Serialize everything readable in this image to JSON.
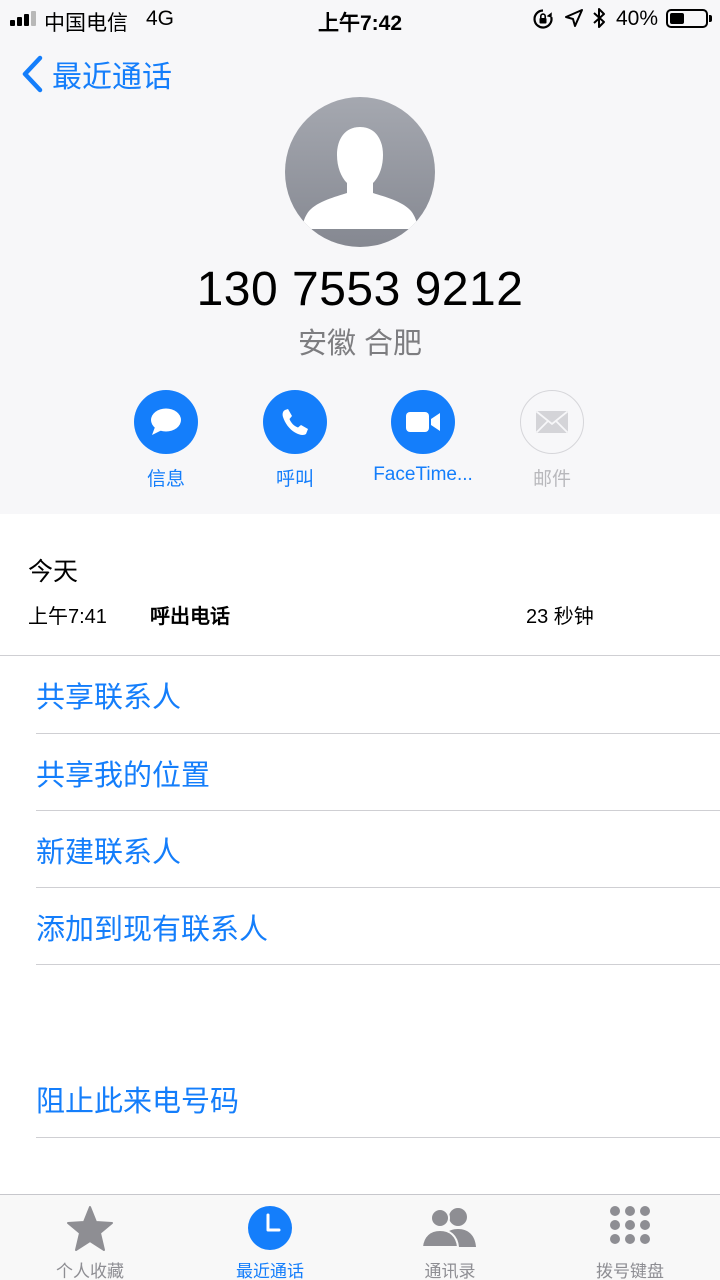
{
  "status_bar": {
    "carrier": "中国电信",
    "network": "4G",
    "time": "上午7:42",
    "battery_percent_text": "40%",
    "battery_level": 0.4,
    "icons": [
      "signal-icon",
      "rotation-lock-icon",
      "location-arrow-icon",
      "bluetooth-icon",
      "battery-icon"
    ]
  },
  "nav": {
    "back_label": "最近通话"
  },
  "contact": {
    "phone_number": "130 7553 9212",
    "location": "安徽 合肥"
  },
  "actions": [
    {
      "label": "信息",
      "icon": "message-icon",
      "enabled": true
    },
    {
      "label": "呼叫",
      "icon": "phone-icon",
      "enabled": true
    },
    {
      "label": "FaceTime...",
      "icon": "video-camera-icon",
      "enabled": true
    },
    {
      "label": "邮件",
      "icon": "mail-icon",
      "enabled": false
    }
  ],
  "history": {
    "day": "今天",
    "calls": [
      {
        "time": "上午7:41",
        "type": "呼出电话",
        "duration": "23 秒钟"
      }
    ]
  },
  "options": [
    "共享联系人",
    "共享我的位置",
    "新建联系人",
    "添加到现有联系人"
  ],
  "block_label": "阻止此来电号码",
  "tab_bar": {
    "tabs": [
      {
        "label": "个人收藏",
        "icon": "star-icon",
        "active": false
      },
      {
        "label": "最近通话",
        "icon": "clock-icon",
        "active": true
      },
      {
        "label": "通讯录",
        "icon": "contacts-icon",
        "active": false
      },
      {
        "label": "拨号键盘",
        "icon": "keypad-icon",
        "active": false
      }
    ]
  },
  "colors": {
    "accent": "#147efb",
    "header_background": "#f7f7f9",
    "secondary_text": "#7d7d80",
    "inactive_tab": "#8e8e93"
  }
}
